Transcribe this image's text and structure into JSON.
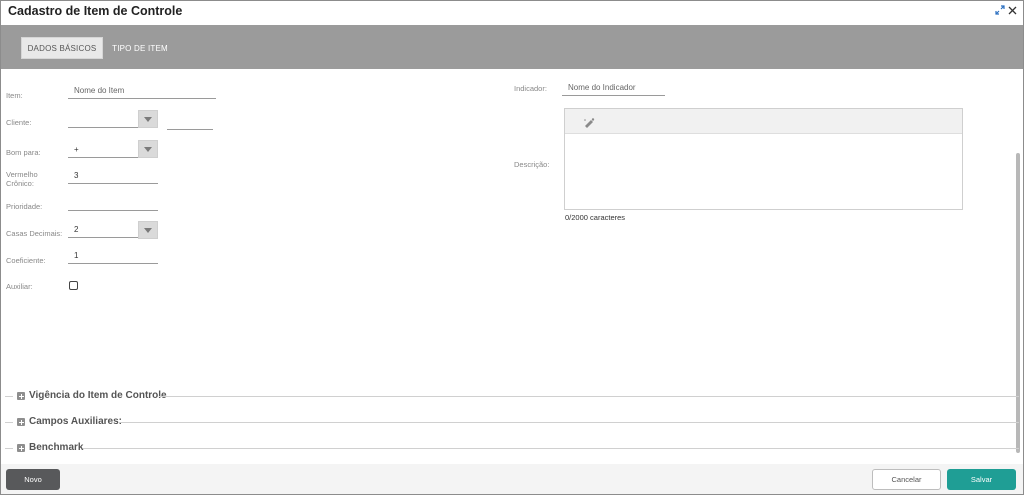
{
  "window": {
    "title": "Cadastro de Item de Controle"
  },
  "tabs": [
    {
      "label": "DADOS BÁSICOS"
    },
    {
      "label": "TIPO DE ITEM"
    }
  ],
  "form": {
    "item_label": "Item:",
    "item_placeholder": "Nome do Item",
    "cliente_label": "Cliente:",
    "bom_para_label": "Bom para:",
    "bom_para_value": "+",
    "vermelho_label": "Vermelho\nCrônico:",
    "vermelho_value": "3",
    "prioridade_label": "Prioridade:",
    "casas_label": "Casas Decimais:",
    "casas_value": "2",
    "coeficiente_label": "Coeficiente:",
    "coeficiente_value": "1",
    "auxiliar_label": "Auxiliar:",
    "auxiliar_checked": false,
    "indicador_label": "Indicador:",
    "indicador_placeholder": "Nome do Indicador",
    "descricao_label": "Descrição:",
    "char_count": "0/2000 caracteres"
  },
  "sections": [
    {
      "title": "Vigência do Item de Controle"
    },
    {
      "title": "Campos Auxiliares:"
    },
    {
      "title": "Benchmark"
    }
  ],
  "footer": {
    "novo_label": "Novo",
    "cancel_label": "Cancelar",
    "save_label": "Salvar"
  },
  "colors": {
    "tabbar": "#9b9b9b",
    "save_button": "#1f9e95",
    "novo_button": "#58595b"
  },
  "icons": {
    "restore": "restore-icon",
    "close": "close-icon",
    "editor_tool": "edit-pencil-icon"
  }
}
